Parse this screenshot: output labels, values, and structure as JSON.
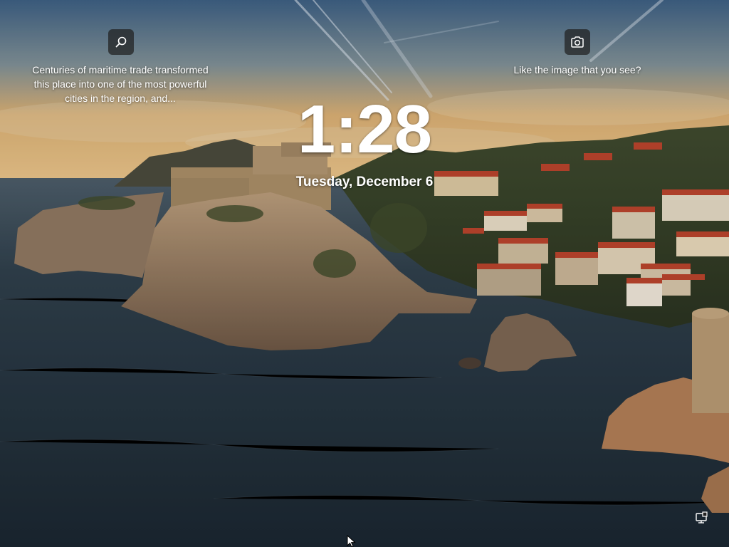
{
  "lock_screen": {
    "time": "1:28",
    "date": "Tuesday, December 6"
  },
  "spotlight": {
    "search_icon": "search-icon",
    "description": "Centuries of maritime trade transformed this place into one of the most powerful cities in the region, and...",
    "camera_icon": "camera-icon",
    "like_prompt": "Like the image that you see?"
  },
  "system_tray": {
    "network_icon": "network-icon"
  },
  "colors": {
    "text": "#ffffff",
    "button_bg": "#202020"
  }
}
